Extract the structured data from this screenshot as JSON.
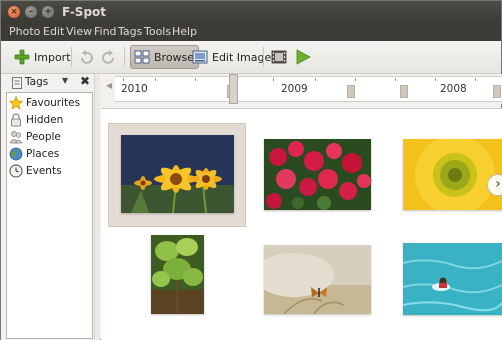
{
  "window": {
    "title": "F-Spot"
  },
  "menubar": {
    "items": [
      "Photo",
      "Edit",
      "View",
      "Find",
      "Tags",
      "Tools",
      "Help"
    ]
  },
  "toolbar": {
    "import_label": "Import",
    "browse_label": "Browse",
    "edit_image_label": "Edit Image",
    "browse_active": true
  },
  "sidebar": {
    "header_label": "Tags",
    "items": [
      {
        "label": "Favourites",
        "icon": "star-icon"
      },
      {
        "label": "Hidden",
        "icon": "lock-icon"
      },
      {
        "label": "People",
        "icon": "people-icon"
      },
      {
        "label": "Places",
        "icon": "globe-icon"
      },
      {
        "label": "Events",
        "icon": "clock-icon"
      }
    ]
  },
  "timeline": {
    "years": [
      "2010",
      "2009",
      "2008"
    ]
  },
  "photos": [
    {
      "subject": "yellow daisies",
      "selected": true
    },
    {
      "subject": "red flowers"
    },
    {
      "subject": "sunflower"
    },
    {
      "subject": "green leaves"
    },
    {
      "subject": "butterfly"
    },
    {
      "subject": "swimmer"
    }
  ],
  "colors": {
    "titlebar": "#3c3b37",
    "selection": "#e2dcd4",
    "close_button": "#e0542a"
  }
}
